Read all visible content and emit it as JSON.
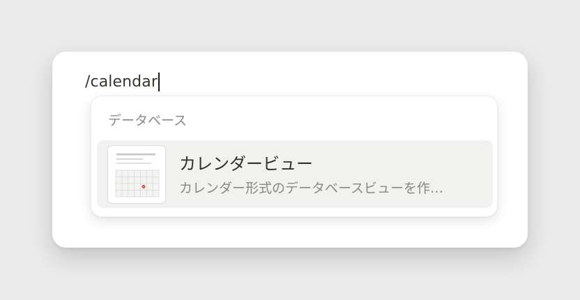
{
  "editor": {
    "input_text": "/calendar"
  },
  "menu": {
    "section_label": "データベース",
    "items": [
      {
        "title": "カレンダービュー",
        "description": "カレンダー形式のデータベースビューを作…",
        "icon": "calendar-thumbnail-icon"
      }
    ]
  },
  "colors": {
    "background": "#ebebeb",
    "card": "#ffffff",
    "item_highlight": "#f1f1ef",
    "calendar_accent_dot": "#d9614f"
  }
}
